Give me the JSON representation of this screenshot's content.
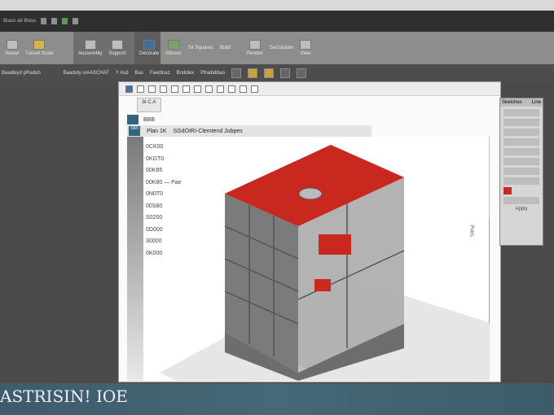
{
  "app": {
    "status_title": "ASTRISIN! IOE"
  },
  "titlebar": {
    "left_text": "Brass ab Blass"
  },
  "ribbon": {
    "groups": [
      {
        "buttons": [
          "Saved",
          "Tunnel Scale"
        ]
      },
      {
        "buttons": [
          "Aussembly",
          "Support"
        ]
      },
      {
        "buttons": [
          "Decorate"
        ]
      },
      {
        "buttons": [
          "Glisses",
          "Sit Squares",
          "Build"
        ]
      },
      {
        "buttons": [
          "Render",
          "Sectulation"
        ]
      },
      {
        "buttons": [
          "View"
        ]
      }
    ]
  },
  "toolbar2": {
    "items": [
      "Baadleyd pRaduh",
      "Baaduty ioAASCHAT",
      "Y Asd",
      "Bas",
      "Faedlnaz",
      "Bnddlex",
      "Pfraibdlbas"
    ]
  },
  "document": {
    "tab_label": "bt C.A",
    "row1_label": "BBB",
    "row2_items": [
      "Plan 1K",
      "SGdOIRI-Clemtend Jubpes"
    ],
    "side_label": "ckn",
    "dimension_labels": [
      "0CK00",
      "0KGT0",
      "00K85",
      "00K80",
      "0N0T0",
      "00S80",
      "S0200",
      "0D000",
      "30000",
      "0K000"
    ],
    "annotation": "Pae",
    "right_dim_label": "PoloL"
  },
  "right_panel": {
    "title": "Sketches",
    "tab": "Line",
    "footer": "Apply"
  },
  "colors": {
    "accent_red": "#c8281e",
    "status_bar": "#3e5b6a"
  }
}
